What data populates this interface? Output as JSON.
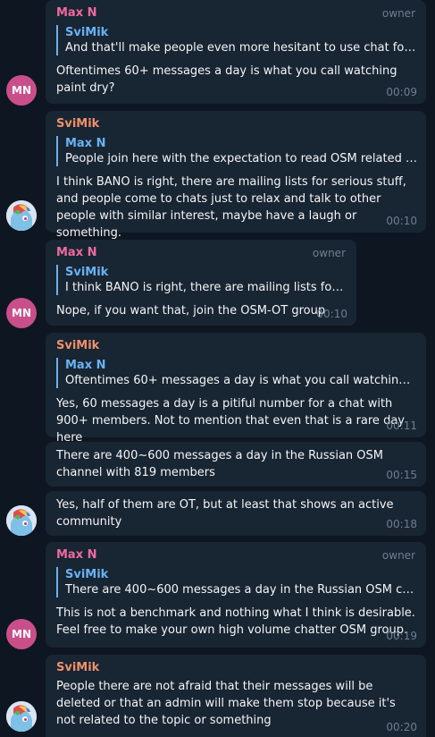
{
  "labels": {
    "owner": "owner"
  },
  "avatars": {
    "maxn_initials": "MN",
    "svimik_icon": "pony-avatar-icon"
  },
  "messages": [
    {
      "sender": "Max N",
      "owner": true,
      "reply_to": "SviMik",
      "reply_text": "And that'll make people even more hesitant to use chat for, well...",
      "text": "Oftentimes 60+ messages a day is what you call watching paint dry?",
      "time": "00:09"
    },
    {
      "sender": "SviMik",
      "owner": false,
      "reply_to": "Max N",
      "reply_text": "People join here with the expectation to read OSM related conv...",
      "text": "I think BANO is right, there are mailing lists for serious stuff, and people come to chats just to relax and talk to other people with similar interest, maybe have a laugh or something.",
      "time": "00:10"
    },
    {
      "sender": "Max N",
      "owner": true,
      "reply_to": "SviMik",
      "reply_text": "I think BANO is right, there are mailing lists for ser...",
      "text": "Nope, if you want that, join the OSM-OT group",
      "time": "00:10"
    },
    {
      "sender": "SviMik",
      "owner": false,
      "reply_to": "Max N",
      "reply_text": "Oftentimes 60+ messages a day is what you call watching paint ...",
      "text": "Yes, 60 messages a day is a pitiful number for a chat with 900+ members. Not to mention that even that is a rare day here",
      "time": "00:11"
    },
    {
      "sender": "",
      "owner": false,
      "text": "There are 400~600 messages a day in the Russian OSM channel with 819 members",
      "time": "00:15"
    },
    {
      "sender": "",
      "owner": false,
      "text": "Yes, half of them are OT, but at least that shows an active community",
      "time": "00:18"
    },
    {
      "sender": "Max N",
      "owner": true,
      "reply_to": "SviMik",
      "reply_text": "There are 400~600 messages a day in the Russian OSM channel...",
      "text": "This is not a benchmark and nothing what I think is desirable. Feel free to make your own high volume chatter OSM group.",
      "time": "00:19"
    },
    {
      "sender": "SviMik",
      "owner": false,
      "text": "People there are not afraid that their messages will be deleted or that an admin will make them stop because it's not related to the topic or something",
      "time": "00:20"
    }
  ]
}
